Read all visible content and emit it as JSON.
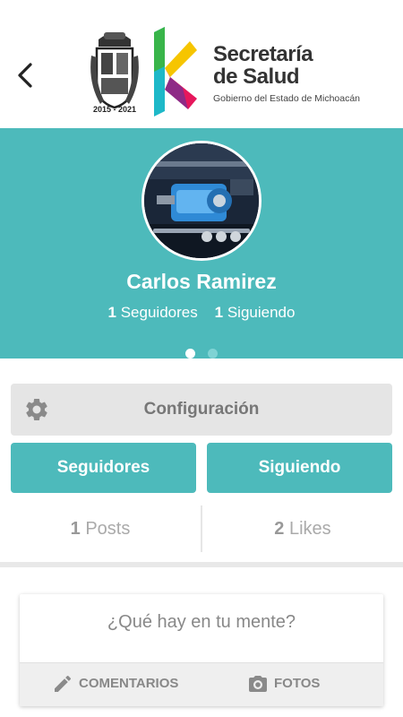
{
  "header": {
    "back_icon": "chevron-left-icon",
    "crest_years": "2015 - 2021",
    "brand_line1": "Secretaría",
    "brand_line2": "de Salud",
    "brand_subtitle": "Gobierno del Estado de Michoacán"
  },
  "profile": {
    "name": "Carlos Ramirez",
    "followers_count": "1",
    "followers_label": "Seguidores",
    "following_count": "1",
    "following_label": "Siguiendo",
    "carousel_pages": 2,
    "carousel_active": 1
  },
  "actions": {
    "settings_label": "Configuración",
    "settings_icon": "gear-icon",
    "followers_button": "Seguidores",
    "following_button": "Siguiendo"
  },
  "stats": {
    "posts_count": "1",
    "posts_label": "Posts",
    "likes_count": "2",
    "likes_label": "Likes"
  },
  "composer": {
    "placeholder": "¿Qué hay en tu mente?",
    "comments_label": "COMENTARIOS",
    "comments_icon": "pencil-icon",
    "photos_label": "FOTOS",
    "photos_icon": "camera-icon"
  },
  "colors": {
    "accent": "#4dbabb",
    "settings_bg": "#e5e5e5"
  }
}
